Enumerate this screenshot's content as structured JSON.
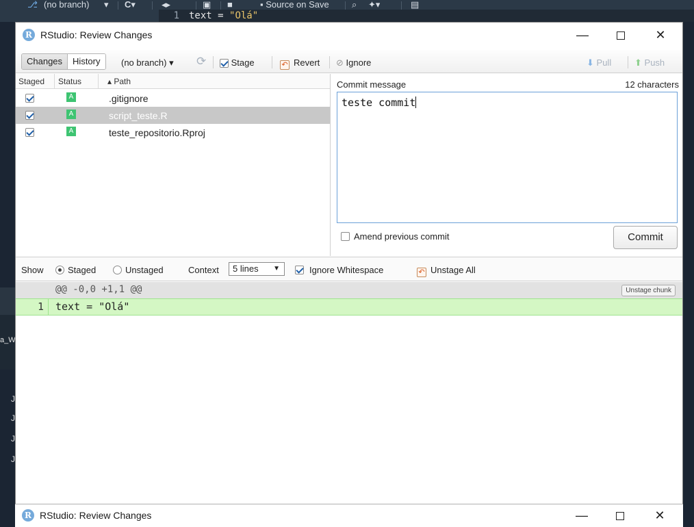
{
  "background": {
    "branch_label": "(no branch)",
    "source_on_save_label": "Source on Save",
    "editor_line_number": "1",
    "editor_code_prefix": "text = ",
    "editor_code_string": "\"Olá\"",
    "strip_fragment": "a_W",
    "strip_letters": [
      "J",
      "J",
      "J",
      "J"
    ]
  },
  "dialog": {
    "title": "RStudio: Review Changes",
    "toolbar": {
      "tab_changes": "Changes",
      "tab_history": "History",
      "branch": "(no branch)",
      "stage_label": "Stage",
      "revert_label": "Revert",
      "ignore_label": "Ignore",
      "pull_label": "Pull",
      "push_label": "Push"
    },
    "file_list": {
      "columns": {
        "staged": "Staged",
        "status": "Status",
        "path": "Path"
      },
      "rows": [
        {
          "staged": true,
          "status": "A",
          "path": ".gitignore",
          "selected": false
        },
        {
          "staged": true,
          "status": "A",
          "path": "script_teste.R",
          "selected": true
        },
        {
          "staged": true,
          "status": "A",
          "path": "teste_repositorio.Rproj",
          "selected": false
        }
      ]
    },
    "commit": {
      "label": "Commit message",
      "char_count": "12 characters",
      "message": "teste commit",
      "amend_label": "Amend previous commit",
      "commit_button": "Commit"
    },
    "diff_controls": {
      "show_label": "Show",
      "staged_label": "Staged",
      "unstaged_label": "Unstaged",
      "context_label": "Context",
      "context_value": "5 lines",
      "ignore_ws_label": "Ignore Whitespace",
      "unstage_all_label": "Unstage All"
    },
    "diff": {
      "hunk_header": "@@ -0,0 +1,1 @@",
      "unstage_chunk": "Unstage chunk",
      "added_line_number": "1",
      "added_line_code": "text = \"Olá\""
    }
  },
  "dialog2": {
    "title": "RStudio: Review Changes"
  },
  "colors": {
    "accent": "#75aadb",
    "status_added": "#3ec472",
    "diff_added_bg": "#d4f7c4",
    "selected_row": "#c8c8c8"
  }
}
